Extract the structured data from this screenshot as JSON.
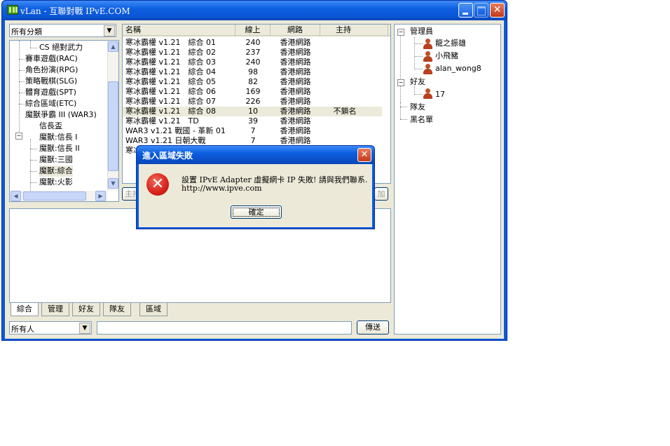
{
  "window": {
    "title": "vLan - 互聯對戰 IPvE.COM"
  },
  "category_combo": {
    "value": "所有分類"
  },
  "category_tree": {
    "items": [
      {
        "label": "CS 絕對武力"
      },
      {
        "label": "賽車遊戲(RAC)"
      },
      {
        "label": "角色扮演(RPG)"
      },
      {
        "label": "策略戰棋(SLG)"
      },
      {
        "label": "體育遊戲(SPT)"
      },
      {
        "label": "綜合區域(ETC)"
      },
      {
        "label": "魔獸爭霸 III (WAR3)"
      },
      {
        "label": "信長盃"
      },
      {
        "label": "魔獸:信長 I"
      },
      {
        "label": "魔獸:信長 II"
      },
      {
        "label": "魔獸:三國"
      },
      {
        "label": "魔獸:綜合"
      },
      {
        "label": "魔獸:火影"
      }
    ]
  },
  "room_list": {
    "headers": {
      "name": "名稱",
      "online": "線上",
      "network": "網路",
      "host": "主持"
    },
    "rows": [
      {
        "name": "寒冰霸權 v1.21　綜合 01",
        "online": "240",
        "network": "香港網路",
        "host": ""
      },
      {
        "name": "寒冰霸權 v1.21　綜合 02",
        "online": "237",
        "network": "香港網路",
        "host": ""
      },
      {
        "name": "寒冰霸權 v1.21　綜合 03",
        "online": "240",
        "network": "香港網路",
        "host": ""
      },
      {
        "name": "寒冰霸權 v1.21　綜合 04",
        "online": "98",
        "network": "香港網路",
        "host": ""
      },
      {
        "name": "寒冰霸權 v1.21　綜合 05",
        "online": "82",
        "network": "香港網路",
        "host": ""
      },
      {
        "name": "寒冰霸權 v1.21　綜合 06",
        "online": "169",
        "network": "香港網路",
        "host": ""
      },
      {
        "name": "寒冰霸權 v1.21　綜合 07",
        "online": "226",
        "network": "香港網路",
        "host": ""
      },
      {
        "name": "寒冰霸權 v1.21　綜合 08",
        "online": "10",
        "network": "香港網路",
        "host": "不鎖名"
      },
      {
        "name": "寒冰霸權 v1.21　TD",
        "online": "39",
        "network": "香港網路",
        "host": ""
      },
      {
        "name": "WAR3 v1.21 戰國 - 革新 01",
        "online": "7",
        "network": "香港網路",
        "host": ""
      },
      {
        "name": "WAR3 v1.21 日朝大戰",
        "online": "7",
        "network": "香港網路",
        "host": ""
      },
      {
        "name": "寒冰",
        "online": "",
        "network": "",
        "host": ""
      }
    ],
    "hidden_button_left": "主持",
    "hidden_button_right": "加"
  },
  "chat_tabs": [
    "綜合",
    "管理",
    "好友",
    "隊友",
    "區域"
  ],
  "recipient_combo": {
    "value": "所有人"
  },
  "send_button": {
    "label": "傳送"
  },
  "user_tree": {
    "groups": [
      {
        "label": "管理員",
        "members": [
          "龍之振雄",
          "小飛豬",
          "alan_wong8"
        ]
      },
      {
        "label": "好友",
        "members": [
          "17"
        ]
      },
      {
        "label": "隊友",
        "members": []
      },
      {
        "label": "黑名單",
        "members": []
      }
    ]
  },
  "error_dialog": {
    "title": "進入區域失敗",
    "message": "設置 IPvE Adapter 虛擬網卡 IP 失敗! 請與我們聯系.",
    "url": "http://www.ipve.com",
    "ok_label": "確定"
  },
  "colors": {
    "titlebar": "#0a5ad8",
    "selected_row": "#ebeadb",
    "error_icon": "#d8211a"
  },
  "icons": {
    "error": "error-x-icon",
    "user": "user-icon",
    "minimize": "minimize-icon",
    "maximize": "maximize-icon",
    "close": "close-icon"
  }
}
